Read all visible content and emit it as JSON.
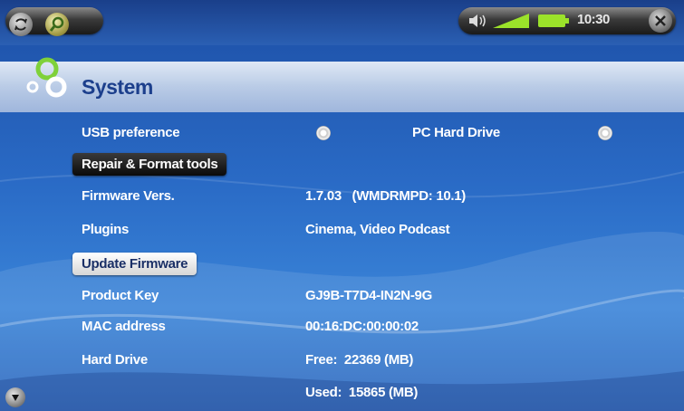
{
  "status_bar": {
    "time": "10:30",
    "left_icons": [
      "cycle-icon",
      "search-icon"
    ],
    "right_icons": [
      "speaker-icon",
      "signal-icon",
      "battery-icon",
      "close-icon"
    ]
  },
  "header": {
    "title": "System",
    "icon": "gears-icon"
  },
  "settings": {
    "usb_preference": {
      "label": "USB preference",
      "value": "PC Hard Drive"
    },
    "repair_button": "Repair & Format tools",
    "firmware": {
      "label": "Firmware Vers.",
      "value": "1.7.03   (WMDRMPD: 10.1)"
    },
    "plugins": {
      "label": "Plugins",
      "value": "Cinema, Video Podcast"
    },
    "update_button": "Update Firmware",
    "product_key": {
      "label": "Product Key",
      "value": "GJ9B-T7D4-IN2N-9G"
    },
    "mac_address": {
      "label": "MAC address",
      "value": "00:16:DC:00:00:02"
    },
    "hard_drive": {
      "label": "Hard Drive",
      "free": "Free:  22369 (MB)",
      "used": "Used:  15865 (MB)"
    }
  },
  "colors": {
    "background": "#2a6bc6",
    "header_text": "#1c3f8c",
    "row_text": "#ffffff"
  }
}
